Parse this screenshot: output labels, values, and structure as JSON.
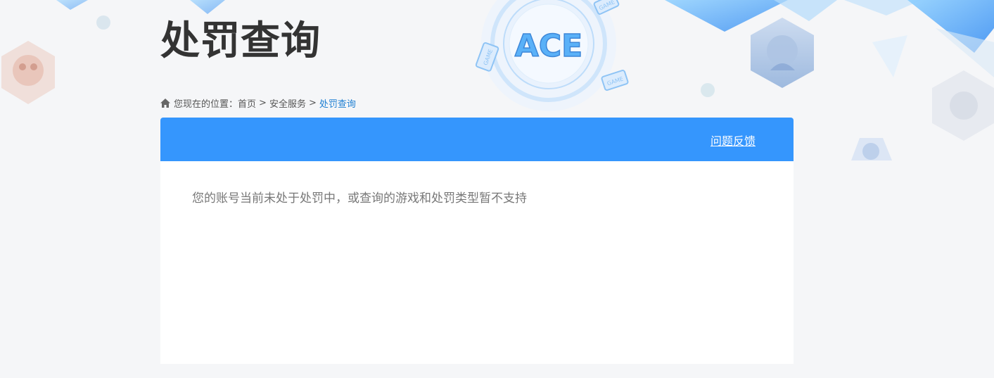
{
  "page": {
    "title": "处罚查询"
  },
  "breadcrumb": {
    "prefix": "您现在的位置：",
    "items": [
      "首页",
      "安全服务"
    ],
    "separator": ">",
    "current": "处罚查询",
    "icon": "home-icon"
  },
  "logo": {
    "text": "ACE",
    "badges": [
      "GAME",
      "GAME",
      "GAME"
    ]
  },
  "panel": {
    "feedback_label": "问题反馈",
    "message": "您的账号当前未处于处罚中，或查询的游戏和处罚类型暂不支持"
  },
  "colors": {
    "background": "#f5f6f8",
    "header_blue": "#3596fd",
    "breadcrumb_current": "#1e7fd2",
    "title_text": "#333333",
    "message_text": "#777777",
    "decoration_blue": "#5ab1f8"
  }
}
